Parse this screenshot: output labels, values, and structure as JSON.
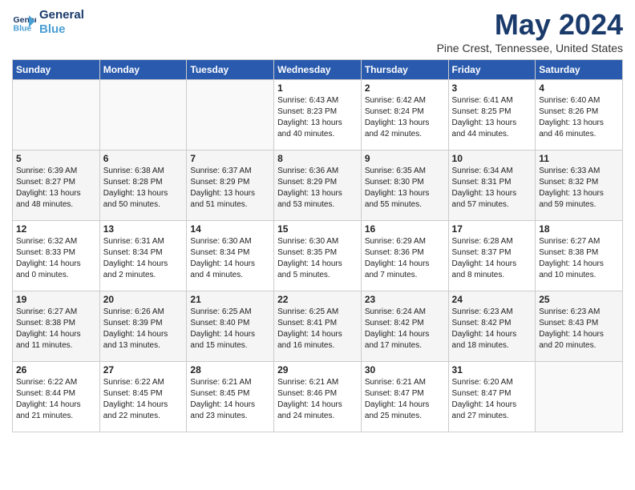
{
  "logo": {
    "line1": "General",
    "line2": "Blue"
  },
  "title": "May 2024",
  "location": "Pine Crest, Tennessee, United States",
  "days_of_week": [
    "Sunday",
    "Monday",
    "Tuesday",
    "Wednesday",
    "Thursday",
    "Friday",
    "Saturday"
  ],
  "weeks": [
    [
      {
        "day": "",
        "info": ""
      },
      {
        "day": "",
        "info": ""
      },
      {
        "day": "",
        "info": ""
      },
      {
        "day": "1",
        "info": "Sunrise: 6:43 AM\nSunset: 8:23 PM\nDaylight: 13 hours\nand 40 minutes."
      },
      {
        "day": "2",
        "info": "Sunrise: 6:42 AM\nSunset: 8:24 PM\nDaylight: 13 hours\nand 42 minutes."
      },
      {
        "day": "3",
        "info": "Sunrise: 6:41 AM\nSunset: 8:25 PM\nDaylight: 13 hours\nand 44 minutes."
      },
      {
        "day": "4",
        "info": "Sunrise: 6:40 AM\nSunset: 8:26 PM\nDaylight: 13 hours\nand 46 minutes."
      }
    ],
    [
      {
        "day": "5",
        "info": "Sunrise: 6:39 AM\nSunset: 8:27 PM\nDaylight: 13 hours\nand 48 minutes."
      },
      {
        "day": "6",
        "info": "Sunrise: 6:38 AM\nSunset: 8:28 PM\nDaylight: 13 hours\nand 50 minutes."
      },
      {
        "day": "7",
        "info": "Sunrise: 6:37 AM\nSunset: 8:29 PM\nDaylight: 13 hours\nand 51 minutes."
      },
      {
        "day": "8",
        "info": "Sunrise: 6:36 AM\nSunset: 8:29 PM\nDaylight: 13 hours\nand 53 minutes."
      },
      {
        "day": "9",
        "info": "Sunrise: 6:35 AM\nSunset: 8:30 PM\nDaylight: 13 hours\nand 55 minutes."
      },
      {
        "day": "10",
        "info": "Sunrise: 6:34 AM\nSunset: 8:31 PM\nDaylight: 13 hours\nand 57 minutes."
      },
      {
        "day": "11",
        "info": "Sunrise: 6:33 AM\nSunset: 8:32 PM\nDaylight: 13 hours\nand 59 minutes."
      }
    ],
    [
      {
        "day": "12",
        "info": "Sunrise: 6:32 AM\nSunset: 8:33 PM\nDaylight: 14 hours\nand 0 minutes."
      },
      {
        "day": "13",
        "info": "Sunrise: 6:31 AM\nSunset: 8:34 PM\nDaylight: 14 hours\nand 2 minutes."
      },
      {
        "day": "14",
        "info": "Sunrise: 6:30 AM\nSunset: 8:34 PM\nDaylight: 14 hours\nand 4 minutes."
      },
      {
        "day": "15",
        "info": "Sunrise: 6:30 AM\nSunset: 8:35 PM\nDaylight: 14 hours\nand 5 minutes."
      },
      {
        "day": "16",
        "info": "Sunrise: 6:29 AM\nSunset: 8:36 PM\nDaylight: 14 hours\nand 7 minutes."
      },
      {
        "day": "17",
        "info": "Sunrise: 6:28 AM\nSunset: 8:37 PM\nDaylight: 14 hours\nand 8 minutes."
      },
      {
        "day": "18",
        "info": "Sunrise: 6:27 AM\nSunset: 8:38 PM\nDaylight: 14 hours\nand 10 minutes."
      }
    ],
    [
      {
        "day": "19",
        "info": "Sunrise: 6:27 AM\nSunset: 8:38 PM\nDaylight: 14 hours\nand 11 minutes."
      },
      {
        "day": "20",
        "info": "Sunrise: 6:26 AM\nSunset: 8:39 PM\nDaylight: 14 hours\nand 13 minutes."
      },
      {
        "day": "21",
        "info": "Sunrise: 6:25 AM\nSunset: 8:40 PM\nDaylight: 14 hours\nand 15 minutes."
      },
      {
        "day": "22",
        "info": "Sunrise: 6:25 AM\nSunset: 8:41 PM\nDaylight: 14 hours\nand 16 minutes."
      },
      {
        "day": "23",
        "info": "Sunrise: 6:24 AM\nSunset: 8:42 PM\nDaylight: 14 hours\nand 17 minutes."
      },
      {
        "day": "24",
        "info": "Sunrise: 6:23 AM\nSunset: 8:42 PM\nDaylight: 14 hours\nand 18 minutes."
      },
      {
        "day": "25",
        "info": "Sunrise: 6:23 AM\nSunset: 8:43 PM\nDaylight: 14 hours\nand 20 minutes."
      }
    ],
    [
      {
        "day": "26",
        "info": "Sunrise: 6:22 AM\nSunset: 8:44 PM\nDaylight: 14 hours\nand 21 minutes."
      },
      {
        "day": "27",
        "info": "Sunrise: 6:22 AM\nSunset: 8:45 PM\nDaylight: 14 hours\nand 22 minutes."
      },
      {
        "day": "28",
        "info": "Sunrise: 6:21 AM\nSunset: 8:45 PM\nDaylight: 14 hours\nand 23 minutes."
      },
      {
        "day": "29",
        "info": "Sunrise: 6:21 AM\nSunset: 8:46 PM\nDaylight: 14 hours\nand 24 minutes."
      },
      {
        "day": "30",
        "info": "Sunrise: 6:21 AM\nSunset: 8:47 PM\nDaylight: 14 hours\nand 25 minutes."
      },
      {
        "day": "31",
        "info": "Sunrise: 6:20 AM\nSunset: 8:47 PM\nDaylight: 14 hours\nand 27 minutes."
      },
      {
        "day": "",
        "info": ""
      }
    ]
  ]
}
